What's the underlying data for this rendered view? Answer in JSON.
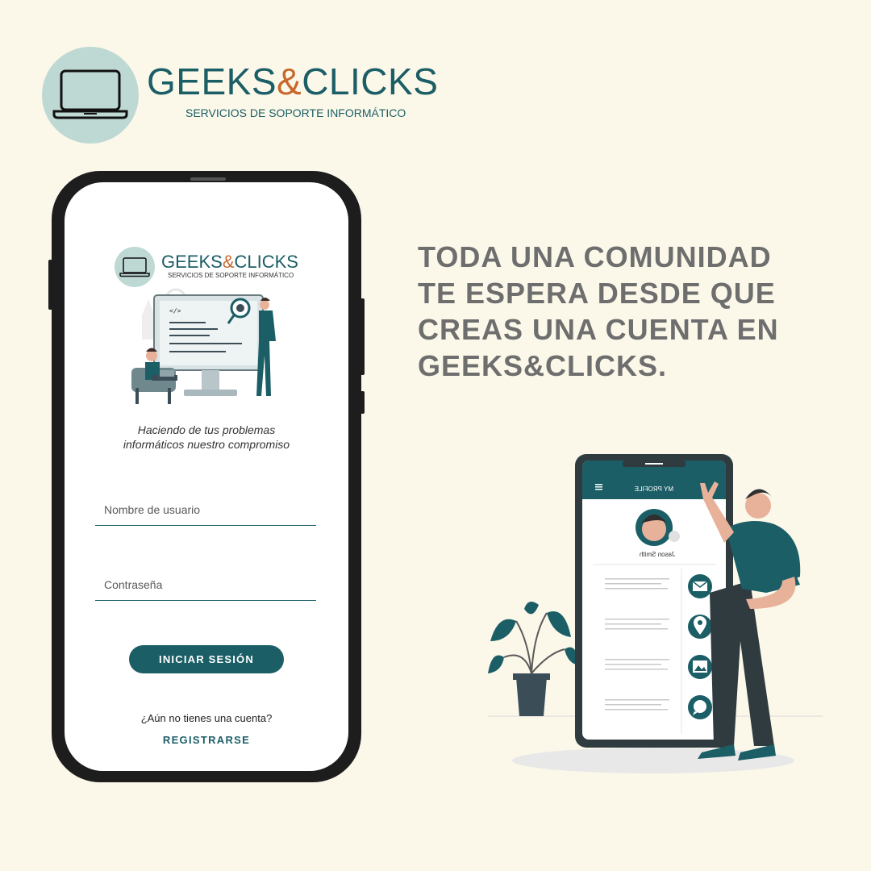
{
  "brand": {
    "name_part1": "GEEKS",
    "name_amp": "&",
    "name_part2": "CLICKS",
    "tagline": "SERVICIOS DE SOPORTE INFORMÁTICO",
    "primary_color": "#1b5e66",
    "accent_color": "#c8682c",
    "circle_color": "#bed9d4",
    "logo_icon": "laptop-icon"
  },
  "headline": {
    "lines": [
      "TODA UNA COMUNIDAD",
      "TE ESPERA DESDE QUE",
      "CREAS UNA CUENTA EN",
      "GEEKS&CLICKS."
    ]
  },
  "login_screen": {
    "brand_name_part1": "GEEKS",
    "brand_name_amp": "&",
    "brand_name_part2": "CLICKS",
    "brand_tagline": "SERVICIOS DE SOPORTE INFORMÁTICO",
    "slogan_lines": [
      "Haciendo de tus problemas",
      "informáticos nuestro compromiso"
    ],
    "username_placeholder": "Nombre de usuario",
    "password_placeholder": "Contraseña",
    "login_button": "INICIAR SESIÓN",
    "no_account_text": "¿Aún no tienes una cuenta?",
    "register_link": "REGISTRARSE",
    "code_tag": "</>"
  },
  "profile_illustration": {
    "header_title": "MY PROFILE",
    "user_name": "Jason Smith",
    "icons": [
      "envelope-icon",
      "location-pin-icon",
      "image-icon",
      "chat-bubble-icon"
    ]
  }
}
